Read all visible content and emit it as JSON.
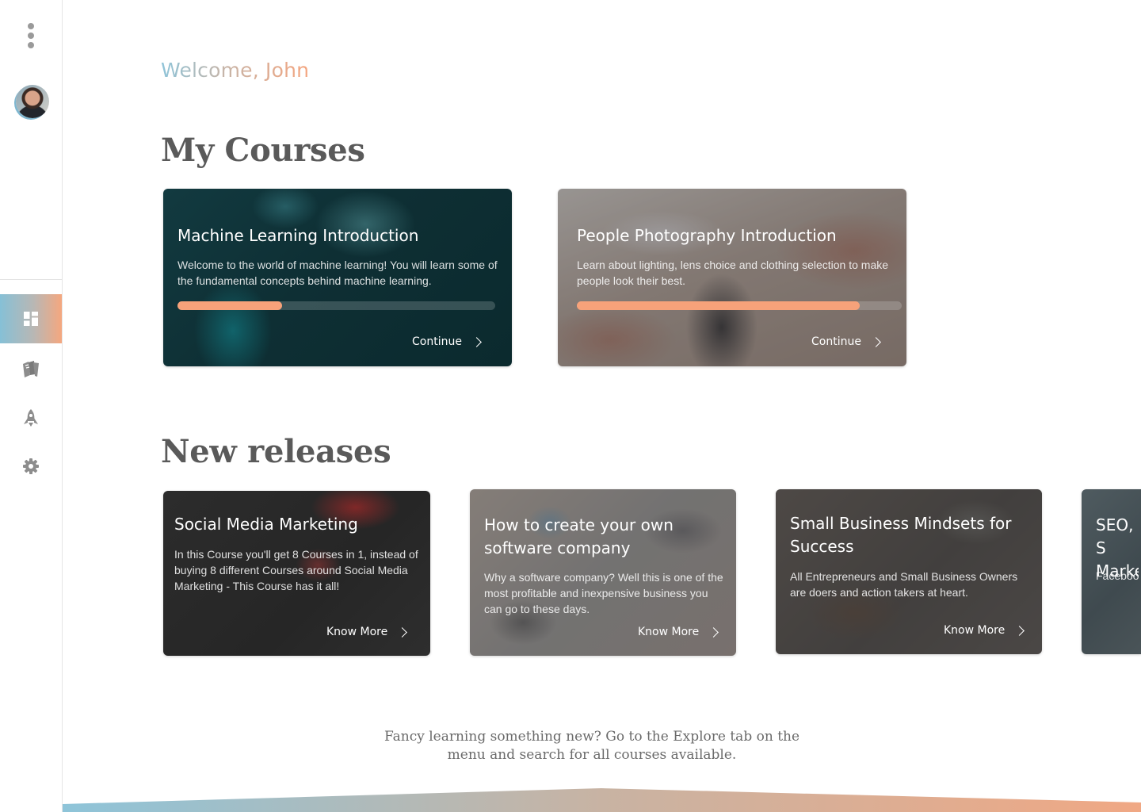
{
  "sidebar": {
    "menu_icon": "kebab-menu-icon",
    "avatar_icon": "user-avatar",
    "nav": [
      {
        "icon": "dashboard-icon",
        "active": true
      },
      {
        "icon": "books-icon",
        "active": false
      },
      {
        "icon": "rocket-icon",
        "active": false
      },
      {
        "icon": "gear-icon",
        "active": false
      }
    ],
    "accent_gradient": [
      "#86c0d6",
      "#f5a77f"
    ]
  },
  "welcome": "Welcome, John",
  "my_courses": {
    "title": "My Courses",
    "items": [
      {
        "title": "Machine Learning Introduction",
        "description": "Welcome to the world of machine learning! You will learn some of the fundamental concepts behind machine learning.",
        "progress": 0.33,
        "action": "Continue"
      },
      {
        "title": "People Photography Introduction",
        "description": "Learn about lighting, lens choice and clothing selection to make people look their best.",
        "progress": 0.87,
        "action": "Continue"
      }
    ]
  },
  "new_releases": {
    "title": "New releases",
    "items": [
      {
        "title": "Social Media Marketing",
        "description": "In this Course you'll get 8 Courses in 1, instead of buying 8 different Courses around Social Media Marketing - This Course has it all!",
        "action": "Know More"
      },
      {
        "title": "How to create your own software company",
        "description": "Why a software company? Well this is one of the most profitable and inexpensive business you can go to these days.",
        "action": "Know More"
      },
      {
        "title": "Small Business Mindsets for Success",
        "description": "All Entrepreneurs and Small Business Owners are doers and action takers at heart.",
        "action": "Know More"
      },
      {
        "title": "SEO, S Marke",
        "description": "Facebook SEO, Vide Website &"
      }
    ]
  },
  "footer_note": "Fancy learning something new? Go to the Explore tab on the menu and search for all courses available.",
  "colors": {
    "progress_fill": "#f7a27a",
    "heading": "#5a5a5a"
  }
}
